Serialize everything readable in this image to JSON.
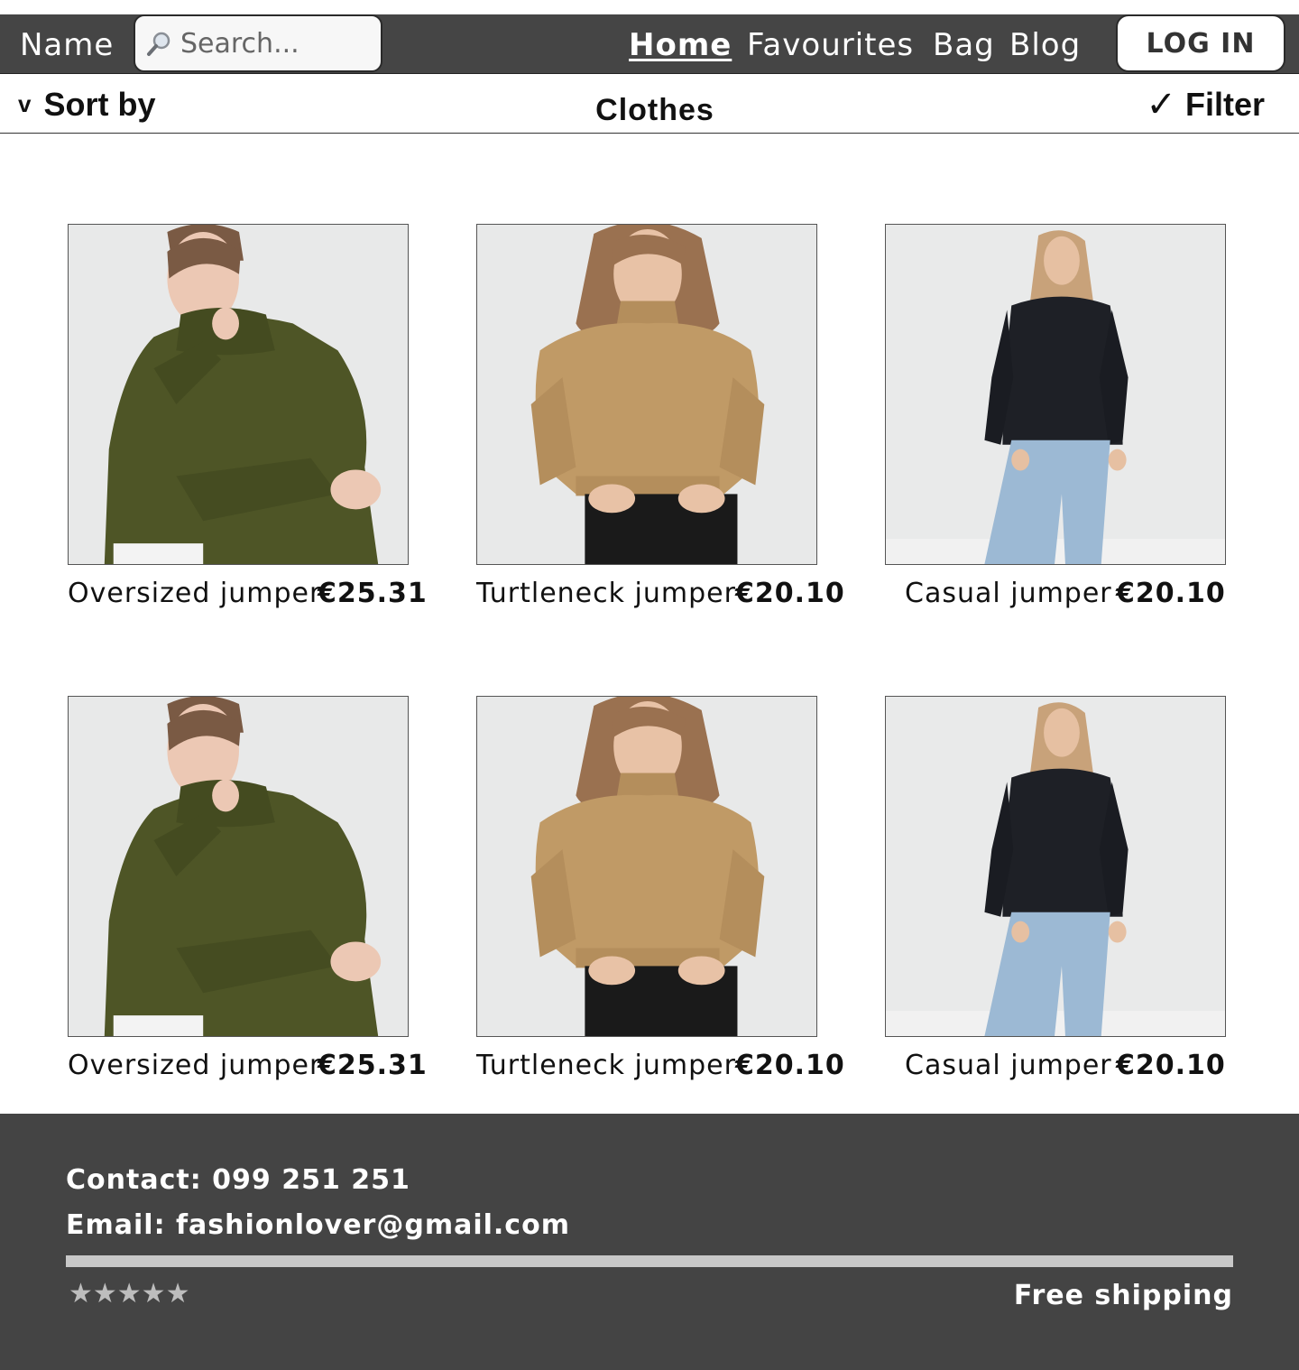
{
  "header": {
    "brand": "Name",
    "search_placeholder": "Search...",
    "nav": [
      {
        "label": "Home",
        "active": true
      },
      {
        "label": "Favourites",
        "active": false
      },
      {
        "label": "Bag",
        "active": false
      },
      {
        "label": "Blog",
        "active": false
      }
    ],
    "login_label": "LOG IN"
  },
  "toolbar": {
    "sort_icon": "chevron-down-icon",
    "sort_label": "Sort by",
    "category": "Clothes",
    "filter_icon": "check-icon",
    "filter_label": "Filter"
  },
  "products": [
    {
      "name": "Oversized jumper",
      "price": "€25.31",
      "image": "woman-green-turtleneck-jumper"
    },
    {
      "name": "Turtleneck jumper",
      "price": "€20.10",
      "image": "woman-camel-turtleneck-jumper"
    },
    {
      "name": "Casual jumper",
      "price": "€20.10",
      "image": "woman-black-jumper-blue-jeans"
    },
    {
      "name": "Oversized jumper",
      "price": "€25.31",
      "image": "woman-green-turtleneck-jumper"
    },
    {
      "name": "Turtleneck jumper",
      "price": "€20.10",
      "image": "woman-camel-turtleneck-jumper"
    },
    {
      "name": "Casual jumper",
      "price": "€20.10",
      "image": "woman-black-jumper-blue-jeans"
    }
  ],
  "footer": {
    "contact": "Contact: 099 251 251",
    "email": "Email: fashionlover@gmail.com",
    "stars": "★★★★★",
    "shipping": "Free shipping"
  },
  "colors": {
    "bar_bg": "#454545",
    "footer_bg": "#444444",
    "jumper_green": "#4e5526",
    "jumper_camel": "#c09a66",
    "jumper_black": "#1e2026",
    "jeans_blue": "#9cb9d4"
  }
}
